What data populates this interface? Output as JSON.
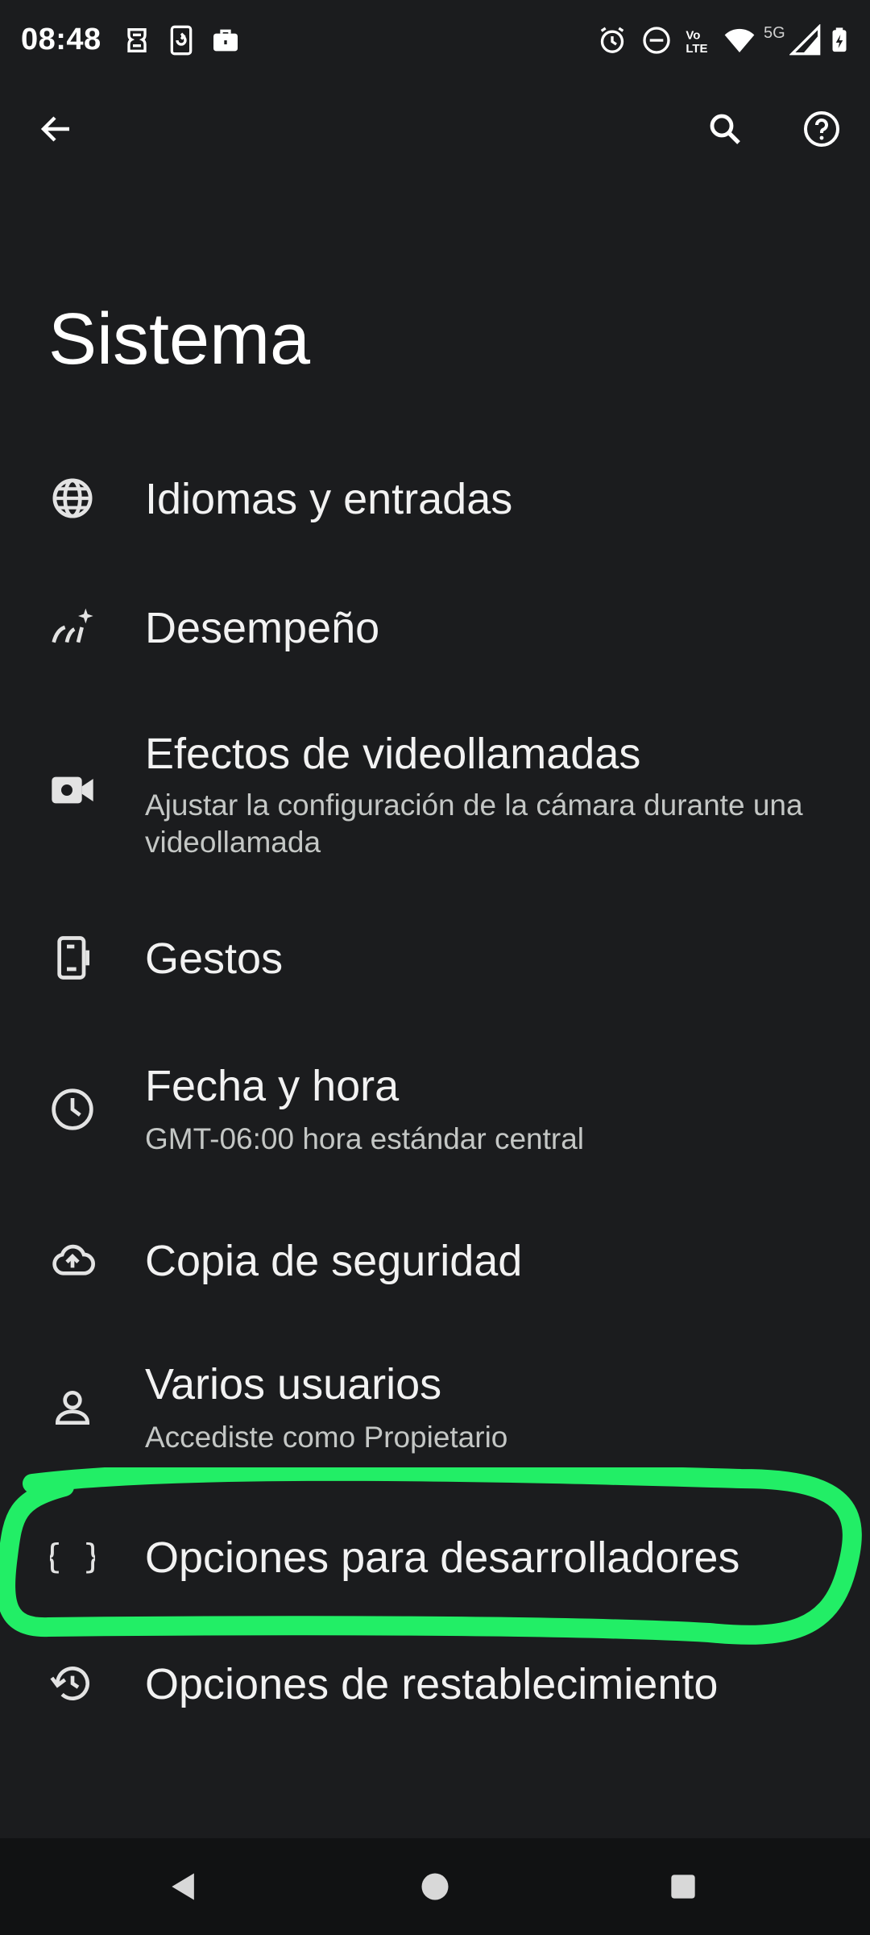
{
  "status_bar": {
    "time": "08:48",
    "network_label": "5G",
    "left_icons": [
      "face-unlock-icon",
      "phone-sync-icon",
      "briefcase-icon"
    ],
    "right_icons": [
      "alarm-icon",
      "do-not-disturb-icon",
      "volte-icon",
      "wifi-icon",
      "signal-icon",
      "battery-icon"
    ]
  },
  "top_bar": {
    "icons": [
      "back-arrow-icon",
      "search-icon",
      "help-icon"
    ]
  },
  "page": {
    "title": "Sistema"
  },
  "items": [
    {
      "icon": "globe-icon",
      "title": "Idiomas y entradas",
      "subtitle": ""
    },
    {
      "icon": "performance-icon",
      "title": "Desempeño",
      "subtitle": ""
    },
    {
      "icon": "video-camera-icon",
      "title": "Efectos de videollamadas",
      "subtitle": "Ajustar la configuración de la cámara durante una videollamada"
    },
    {
      "icon": "phone-gesture-icon",
      "title": "Gestos",
      "subtitle": ""
    },
    {
      "icon": "clock-icon",
      "title": "Fecha y hora",
      "subtitle": "GMT-06:00 hora estándar central"
    },
    {
      "icon": "cloud-upload-icon",
      "title": "Copia de seguridad",
      "subtitle": ""
    },
    {
      "icon": "person-icon",
      "title": "Varios usuarios",
      "subtitle": "Accediste como Propietario"
    },
    {
      "icon": "braces-icon",
      "title": "Opciones para desarrolladores",
      "subtitle": ""
    },
    {
      "icon": "restore-icon",
      "title": "Opciones de restablecimiento",
      "subtitle": ""
    }
  ],
  "annotation": {
    "color": "#22ee66"
  },
  "nav_bar": {
    "icons": [
      "nav-back-icon",
      "nav-home-icon",
      "nav-recents-icon"
    ]
  }
}
